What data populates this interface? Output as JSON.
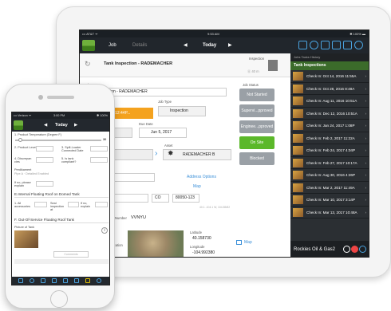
{
  "tablet": {
    "status": {
      "carrier": "••• AT&T ᯤ",
      "time": "9:53 AM",
      "battery": "✱ 100% ▬"
    },
    "nav": {
      "back": "Job",
      "details": "Details",
      "prev": "◀",
      "date": "Today",
      "next": "▶"
    },
    "header": {
      "title": "Tank Inspection  - RADEMACHER",
      "inspection_label": "Inspection",
      "sub": "⓪ 40 m"
    },
    "job_name_label": "Job Name",
    "job_name_value": "Tank Inspection  - RADEMACHER",
    "job_type_label": "Job Type",
    "job_type_value": "Inspection",
    "start_value": "5, 2017 12:44P...",
    "due_label": "Due Date",
    "due_value": "Jun 5, 2017",
    "job_status_label": "Job Status",
    "status_buttons": [
      "Not Started",
      "Supervi...pproved",
      "Enginee...pproved",
      "On Site",
      "Blocked"
    ],
    "asset_label": "Asset",
    "asset_value": "RADEMACHER B",
    "south_value": "uth",
    "address_options": "Address Options",
    "map_link": "Map",
    "state_value": "CO",
    "zip_value": "80050-123",
    "coords_small": "40.1 -104.1 W, 104.85/82",
    "number_label": "Number",
    "number_value": "VVNYU",
    "location_label": "Location",
    "latitude_label": "Latitude",
    "latitude_value": "40.158730",
    "longitude_label": "Longitude",
    "longitude_value": "-104.992380",
    "map_link2": "Map",
    "sidebar": {
      "head": "Jobs  Tasks  History",
      "title": "Tank Inspections",
      "items": [
        "Check In: Oct 14, 2016 11:55A",
        "Check In: Oct 28, 2016 8:48A",
        "Check In: Aug 11, 2016 10:51A",
        "Check In: Dec 12, 2016 10:51A",
        "Check In: Jan 24, 2017 1:08P",
        "Check In: Feb 2, 2017 11:22A",
        "Check In: Feb 24, 2017 4:04P",
        "Check In: Feb 27, 2017 10:17A",
        "Check In: Aug 30, 2016 4:26P",
        "Check In: Mar 2, 2017 11:49A",
        "Check In: Mar 10, 2017 3:14P",
        "Check In: Mar 13, 2017 10:48A"
      ],
      "footer": "Rockies Oil & Gas2"
    }
  },
  "phone": {
    "status": {
      "carrier": "••• Verizon ᯤ",
      "time": "3:00 PM",
      "battery": "✱ 100%"
    },
    "nav": {
      "prev": "◀",
      "date": "Today",
      "next": "▶"
    },
    "q1": "1. Product Temperature (Degree F)",
    "slider_max": "30",
    "q2a": "2. Product Level(ft)",
    "q2b": "3. Spill-Loader Connected Date",
    "q3a": "4. Discrepan cies",
    "q3b": "5. Is tank compliant?",
    "q4": "Predikament",
    "q4_sub": "Pipe A · Detailed Enabled",
    "q5": "If no, please explain",
    "section1": "E.Internal Floating Roof on Domed Tank",
    "q6a": "1. All accessories",
    "q6b": "Seal inspection at",
    "q6c": "If no, explain",
    "section2": "F. Out-Of-Service Floating Roof Tank",
    "photo_label": "Picture of Tank",
    "comments": "Comments"
  },
  "colors": {
    "green": "#5bb82a",
    "orange": "#f4a21e",
    "dark": "#21262c",
    "link": "#3a8fd8"
  }
}
